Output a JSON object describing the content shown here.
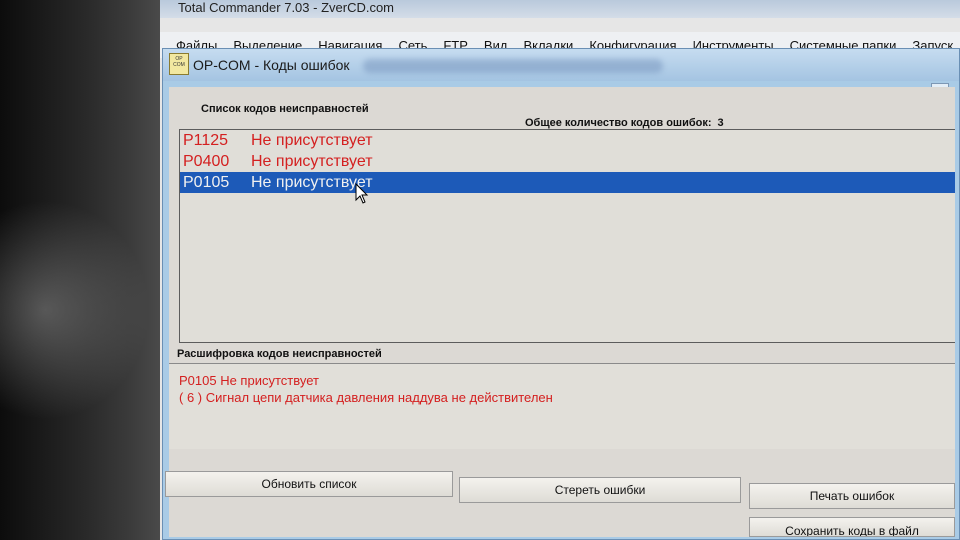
{
  "background_window": {
    "title": "Total Commander 7.03 - ZverCD.com",
    "menu": [
      "Файлы",
      "Выделение",
      "Навигация",
      "Сеть",
      "FTP",
      "Вид",
      "Вкладки",
      "Конфигурация",
      "Инструменты",
      "Системные папки",
      "Запуск"
    ]
  },
  "dialog": {
    "icon_text": "OP COM",
    "title": "OP-COM - Коды ошибок",
    "list_header": "Список кодов неисправностей",
    "count_label": "Общее количество кодов ошибок:",
    "count_value": "3",
    "codes": [
      {
        "code": "P1125",
        "status": "Не присутствует"
      },
      {
        "code": "P0400",
        "status": "Не присутствует"
      },
      {
        "code": "P0105",
        "status": "Не присутствует"
      }
    ],
    "decode_header": "Расшифровка кодов неисправностей",
    "decode_lines": [
      "P0105  Не присутствует",
      "( 6 )  Сигнал цепи датчика давления наддува не действителен"
    ],
    "buttons": {
      "refresh": "Обновить список",
      "clear": "Стереть ошибки",
      "print": "Печать ошибок",
      "save": "Сохранить коды в файл"
    }
  },
  "colors": {
    "fault_text": "#d42020",
    "selection": "#1d5ab8",
    "dialog_frame": "#a9cbe6"
  }
}
